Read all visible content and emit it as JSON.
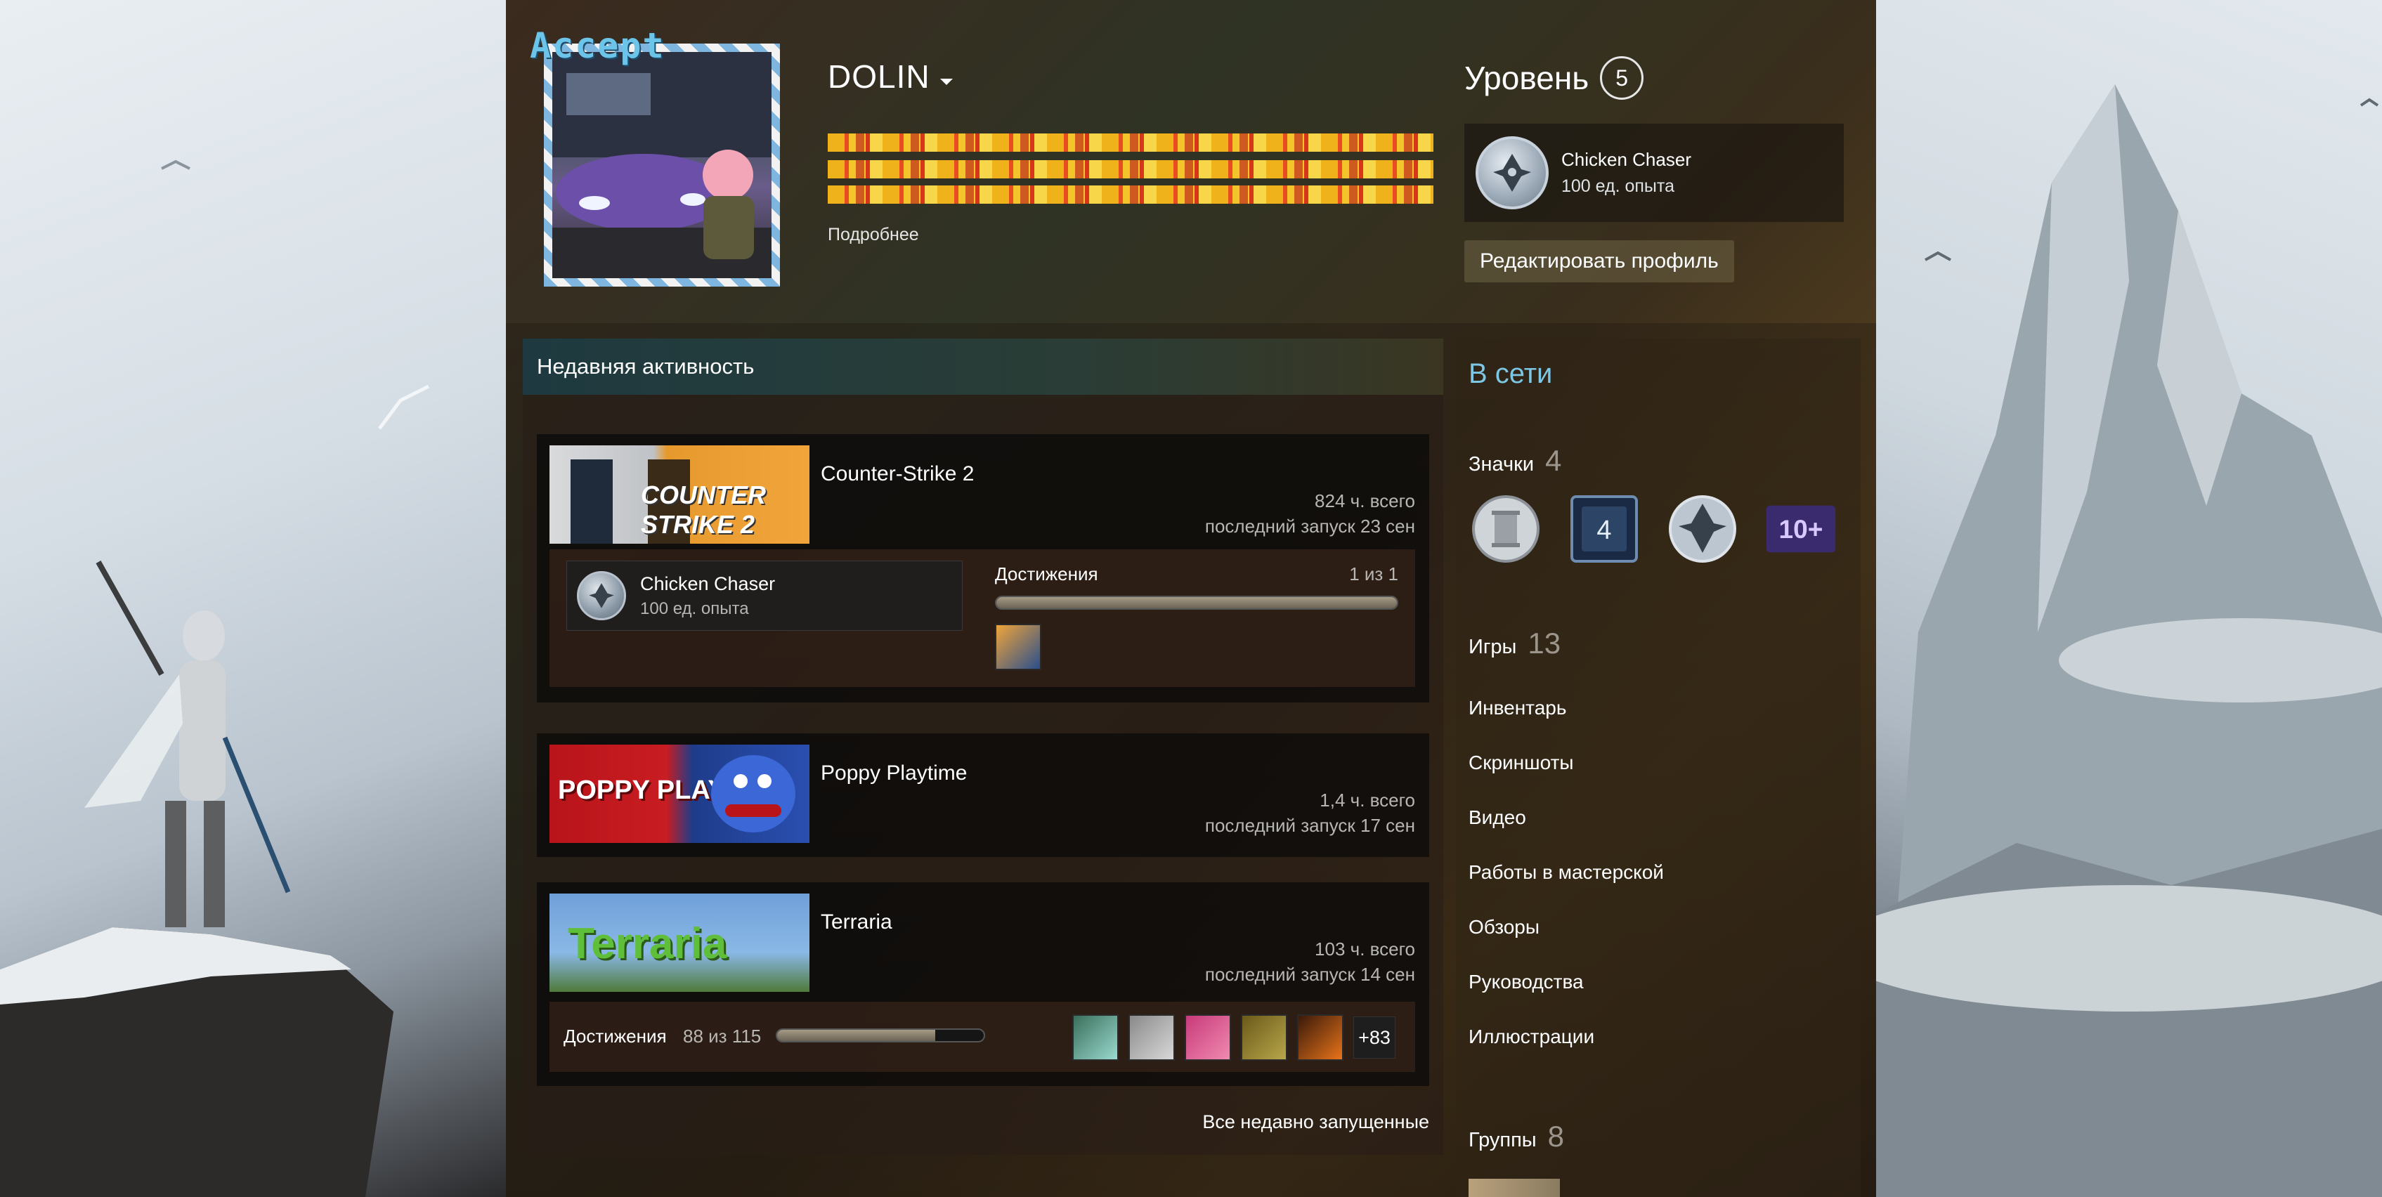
{
  "profile": {
    "logo_text": "Accept",
    "name": "DOLIN",
    "more_link": "Подробнее",
    "level_label": "Уровень",
    "level_value": "5",
    "featured_badge": {
      "title": "Chicken Chaser",
      "xp": "100 ед. опыта"
    },
    "edit_button": "Редактировать профиль"
  },
  "activity": {
    "header": "Недавняя активность",
    "games": [
      {
        "name": "Counter-Strike 2",
        "capsule_text": "COUNTER STRIKE 2",
        "hours": "824 ч. всего",
        "last_played": "последний запуск 23 сен",
        "badge": {
          "title": "Chicken Chaser",
          "xp": "100 ед. опыта"
        },
        "achievements_label": "Достижения",
        "achievements_count": "1 из 1",
        "achievements_progress": 1.0
      },
      {
        "name": "Poppy Playtime",
        "capsule_text": "POPPY PLAYTIME",
        "hours": "1,4 ч. всего",
        "last_played": "последний запуск 17 сен"
      },
      {
        "name": "Terraria",
        "capsule_text": "Terraria",
        "hours": "103 ч. всего",
        "last_played": "последний запуск 14 сен",
        "achievements_label": "Достижения",
        "achievements_count": "88 из 115",
        "achievements_progress": 0.765,
        "more_achievements": "+83"
      }
    ],
    "all_recent_link": "Все недавно запущенные"
  },
  "sidebar": {
    "status": "В сети",
    "badges_label": "Значки",
    "badges_count": "4",
    "badge_10_label": "10+",
    "badge_4_label": "4",
    "games_label": "Игры",
    "games_count": "13",
    "links": [
      "Инвентарь",
      "Скриншоты",
      "Видео",
      "Работы в мастерской",
      "Обзоры",
      "Руководства",
      "Иллюстрации"
    ],
    "groups_label": "Группы",
    "groups_count": "8"
  },
  "colors": {
    "status_online": "#7dc6e4",
    "accent_gold": "#f0b21a"
  }
}
